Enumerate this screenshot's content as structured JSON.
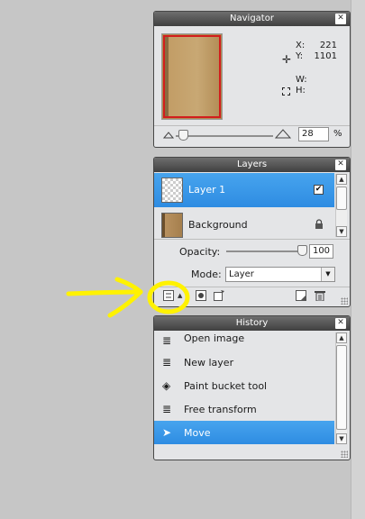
{
  "navigator": {
    "title": "Navigator",
    "x_label": "X:",
    "x_value": "221",
    "y_label": "Y:",
    "y_value": "1101",
    "w_label": "W:",
    "w_value": "",
    "h_label": "H:",
    "h_value": "",
    "zoom_value": "28",
    "zoom_unit": "%"
  },
  "layers": {
    "title": "Layers",
    "items": [
      {
        "name": "Layer 1",
        "active": true,
        "visible": true
      },
      {
        "name": "Background",
        "active": false,
        "locked": true
      }
    ],
    "opacity_label": "Opacity:",
    "opacity_value": "100",
    "mode_label": "Mode:",
    "mode_value": "Layer"
  },
  "history": {
    "title": "History",
    "items": [
      {
        "label": "Open image"
      },
      {
        "label": "New layer"
      },
      {
        "label": "Paint bucket tool"
      },
      {
        "label": "Free transform"
      },
      {
        "label": "Move",
        "active": true
      }
    ]
  },
  "colors": {
    "highlight_yellow": "#fff200",
    "selection_blue": "#2e8ce2",
    "panel_header": "#4a4a4a"
  }
}
